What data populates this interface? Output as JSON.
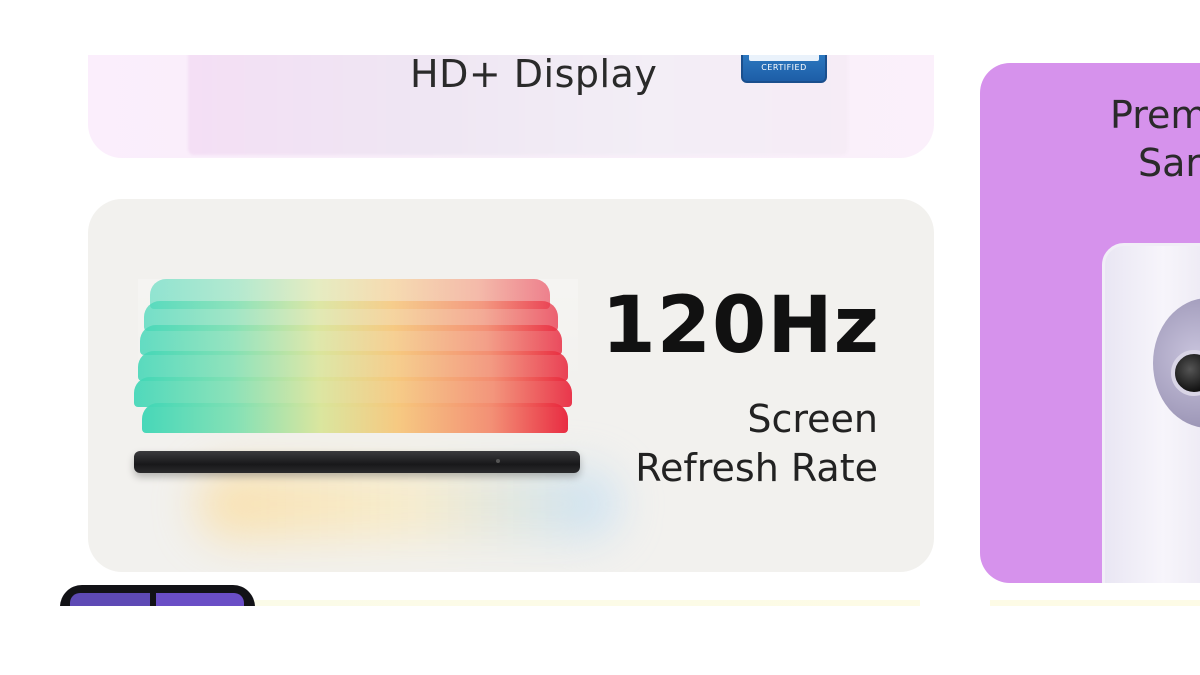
{
  "display_card": {
    "headline": "HD+ Display",
    "badge_text": "CERTIFIED"
  },
  "refresh_card": {
    "value": "120Hz",
    "label_line1": "Screen",
    "label_line2": "Refresh Rate"
  },
  "premium_card": {
    "line1": "Prem",
    "line2": "Sar",
    "background_color": "#d692ec"
  },
  "colors": {
    "refresh_card_bg": "#f2f1ee",
    "display_card_bg": "#fbeefc",
    "badge_blue": "#1d5ea7"
  }
}
